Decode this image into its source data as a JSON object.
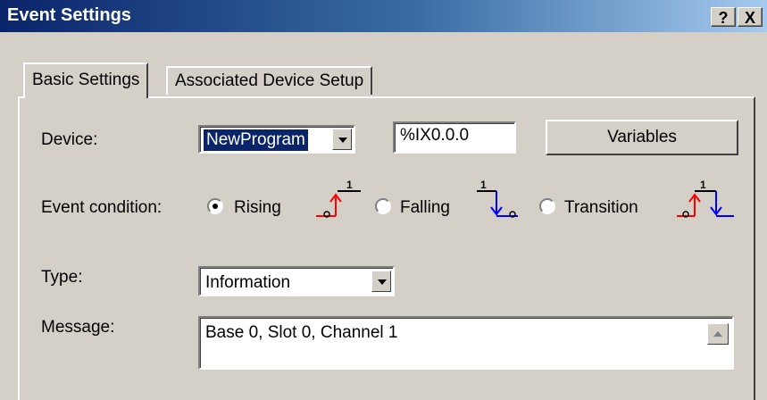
{
  "window": {
    "title": "Event Settings",
    "help_glyph": "?",
    "close_glyph": "X"
  },
  "tabs": [
    {
      "label": "Basic Settings",
      "active": true
    },
    {
      "label": "Associated Device Setup",
      "active": false
    }
  ],
  "form": {
    "device": {
      "label": "Device:",
      "selected": "NewProgram",
      "address": "%IX0.0.0",
      "variables_button": "Variables"
    },
    "event_condition": {
      "label": "Event condition:",
      "options": [
        {
          "label": "Rising",
          "checked": true,
          "icon": "rising-edge-icon"
        },
        {
          "label": "Falling",
          "checked": false,
          "icon": "falling-edge-icon"
        },
        {
          "label": "Transition",
          "checked": false,
          "icon": "transition-edge-icon"
        }
      ],
      "edge_number": "1"
    },
    "type": {
      "label": "Type:",
      "selected": "Information"
    },
    "message": {
      "label": "Message:",
      "value": "Base 0, Slot 0, Channel 1"
    }
  },
  "colors": {
    "rising": "#ff0000",
    "falling": "#0000ff",
    "selection": "#0a246a"
  }
}
